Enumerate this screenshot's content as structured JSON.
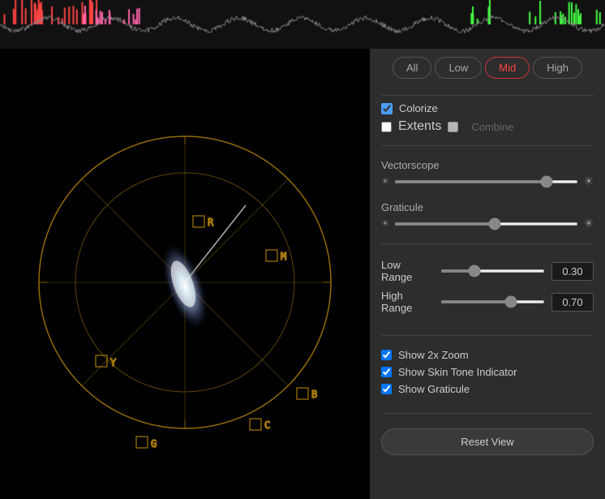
{
  "topWaveform": {
    "description": "Waveform display at top"
  },
  "tabs": {
    "items": [
      "All",
      "Low",
      "Mid",
      "High"
    ],
    "active": "Mid"
  },
  "colorize": {
    "label": "Colorize",
    "checked": true
  },
  "extents": {
    "label": "Extents",
    "checked": false
  },
  "combine": {
    "label": "Combine",
    "disabled": true
  },
  "vectorscope": {
    "label": "Vectorscope",
    "value": 85
  },
  "graticule": {
    "label": "Graticule",
    "value": 55
  },
  "lowRange": {
    "label": "Low Range",
    "sliderValue": 30,
    "displayValue": "0.30"
  },
  "highRange": {
    "label": "High Range",
    "sliderValue": 70,
    "displayValue": "0.70"
  },
  "checks": {
    "showZoom": {
      "label": "Show 2x Zoom",
      "checked": true
    },
    "showSkinTone": {
      "label": "Show Skin Tone Indicator",
      "checked": true
    },
    "showGraticule": {
      "label": "Show Graticule",
      "checked": true
    }
  },
  "resetButton": {
    "label": "Reset View"
  },
  "scopeLabels": [
    "R",
    "M",
    "B",
    "C",
    "G",
    "Y"
  ]
}
